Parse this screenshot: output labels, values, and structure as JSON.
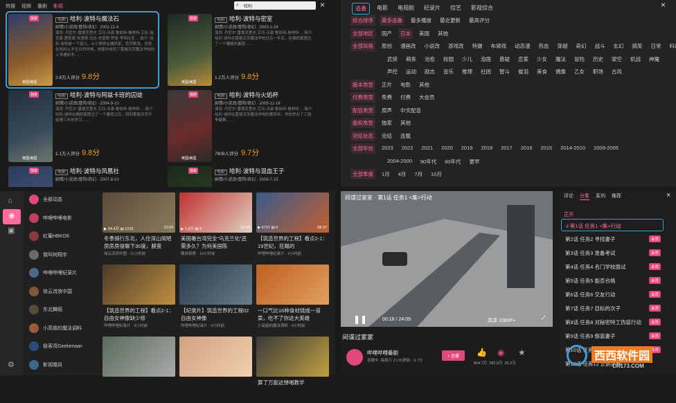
{
  "top_left": {
    "tabs": [
      "热搜",
      "视频",
      "番剧",
      "影视"
    ],
    "active_tab": "影视",
    "search_value": "哈利",
    "cards": [
      {
        "tag": "独家",
        "title": "哈利·波特与魔法石",
        "meta": "剧情/小说改/冒险/奇幻 · 2001-11-4",
        "desc": "演员: 丹尼尔·雷德克里夫 艾玛·沃森 鲁伯特·格林特 艾伦·瑞克曼 理查德·哈里斯 玛吉·史密斯 罗彼·考特拉尼 ... 简介: 哈利·波特是一个孤儿，从小寄养在姨妈家，受尽欺凌。但就在哈利11岁生日的时候，他意外收到了霍格沃茨魔法学校的入学通知书……",
        "count": "2.8万人评分",
        "score": "9.8分",
        "region": "英国/美国"
      },
      {
        "tag": "独家",
        "title": "哈利·波特与密室",
        "meta": "剧情/小说改/冒险/奇幻 · 2003-1-24",
        "desc": "演员: 丹尼尔·雷德克里夫 艾玛·沃森 鲁伯特·格林特 ... 简介: 哈利·波特在霍格沃茨魔法学校过完一年后，在姨妈家度过了一个糟糕的暑假……",
        "count": "1.2万人评分",
        "score": "9.8分",
        "region": "英国/美国"
      },
      {
        "tag": "独家",
        "title": "哈利·波特与阿兹卡班的囚徒",
        "meta": "剧情/小说改/冒险/奇幻 · 2004-9-10",
        "desc": "演员: 丹尼尔·雷德克里夫 艾玛·沃森 鲁伯特·格林特 ... 简介: 哈利·波特在姨妈家度过了一个暑假之后，回到霍格沃茨开始第三年的学习……",
        "count": "1.1万人评分",
        "score": "9.8分",
        "region": "英国/美国"
      },
      {
        "tag": "独家",
        "title": "哈利·波特与火焰杯",
        "meta": "剧情/小说改/冒险/奇幻 · 2005-11-18",
        "desc": "演员: 丹尼尔·雷德克里夫 艾玛·沃森 鲁伯特·格林特 ... 简介: 哈利·波特在霍格沃茨魔法学校的第四年，学校举办了三强争霸赛……",
        "count": "7808人评分",
        "score": "9.7分",
        "region": "英国/美国"
      },
      {
        "tag": "独家",
        "title": "哈利·波特与凤凰社",
        "meta": "剧情/小说改/冒险/奇幻 · 2007-8-10",
        "desc": "",
        "count": "",
        "score": "",
        "region": ""
      },
      {
        "tag": "独家",
        "title": "哈利·波特与混血王子",
        "meta": "剧情/小说改/冒险/奇幻 · 2009-7-15",
        "desc": "",
        "count": "",
        "score": "",
        "region": ""
      }
    ]
  },
  "top_right": {
    "tabs": [
      "追番",
      "电影",
      "电视剧",
      "纪录片",
      "综艺",
      "影视综合"
    ],
    "active_tab": "追番",
    "filters": [
      {
        "label": "综合排序",
        "options": [
          "最多追番",
          "最多播放",
          "最近更新",
          "最高评分"
        ],
        "on": "最多追番"
      },
      {
        "label": "全部地区",
        "options": [
          "国产",
          "日本",
          "美国",
          "其他"
        ],
        "on": "日本"
      },
      {
        "label": "全部风格",
        "options": [
          "原创",
          "漫画改",
          "小说改",
          "游戏改",
          "特摄",
          "布袋戏",
          "动态漫",
          "热血",
          "穿越",
          "奇幻",
          "战斗",
          "玄幻",
          "搞笑",
          "日常",
          "科幻",
          "武侠",
          "萌系",
          "治愈",
          "校园",
          "少儿",
          "泡面",
          "悬疑",
          "恋爱",
          "少女",
          "魔法",
          "冒险",
          "历史",
          "架空",
          "机战",
          "神魔",
          "声控",
          "运动",
          "励志",
          "音乐",
          "推理",
          "社团",
          "智斗",
          "催泪",
          "美食",
          "偶像",
          "乙女",
          "职场",
          "古风"
        ],
        "on": ""
      },
      {
        "label": "版本类型",
        "options": [
          "正片",
          "电影",
          "其他"
        ],
        "on": ""
      },
      {
        "label": "付费类型",
        "options": [
          "免费",
          "付费",
          "大会员"
        ],
        "on": ""
      },
      {
        "label": "配音类型",
        "options": [
          "原声",
          "中文配音"
        ],
        "on": ""
      },
      {
        "label": "版权类型",
        "options": [
          "独家",
          "其他"
        ],
        "on": ""
      },
      {
        "label": "完结状态",
        "options": [
          "完结",
          "连载"
        ],
        "on": ""
      },
      {
        "label": "全部年份",
        "options": [
          "2023",
          "2022",
          "2021",
          "2020",
          "2019",
          "2018",
          "2017",
          "2016",
          "2015",
          "2014-2010",
          "2009-2005",
          "2004-2000",
          "90年代",
          "80年代",
          "更早"
        ],
        "on": ""
      },
      {
        "label": "全部季度",
        "options": [
          "1月",
          "4月",
          "7月",
          "10月"
        ],
        "on": ""
      }
    ]
  },
  "bottom_left": {
    "channels": [
      "全部动态",
      "哔哩哔哩电影",
      "红葡HBKO8",
      "我叫何翔宇",
      "哔哩哔哩纪录片",
      "徐云流浪中国",
      "东北舞蹈",
      "小高姐的魔法调料",
      "极客湾Geekerwan",
      "影视飓风"
    ],
    "videos": [
      {
        "views": "24.4万",
        "dm": "1219",
        "dur": "13:04",
        "title": "冬季骑行东北，人住深山简陋房房房侵聊下30度，膜蛮",
        "up": "徐云流浪中国 · 11小时前"
      },
      {
        "views": "1.6万",
        "dm": "0",
        "dur": "03:48",
        "title": "美国署台湾完全“乌克兰化”还需多久？为何美国陈",
        "up": "鹰网观察 · 10小时前"
      },
      {
        "views": "6727",
        "dm": "0",
        "dur": "08:37",
        "title": "【筑造世界的工程】看点2-1：19世纪，狂飓的",
        "up": "哔哩哔哩纪录片 · 9小时前"
      },
      {
        "views": "",
        "dm": "",
        "dur": "",
        "title": "【筑造世界的工程】看点2-1：自由女神像缺少修",
        "up": "哔哩哔哩纪录片 · 9小时前"
      },
      {
        "views": "",
        "dm": "",
        "dur": "",
        "title": "【纪录片】筑造世界的工程02自由女神像",
        "up": "哔哩哔哩纪录片 · 9小时前"
      },
      {
        "views": "",
        "dm": "",
        "dur": "",
        "title": "一口气比16种食材烧成一道菜，吃不了你这大英雄",
        "up": "小高姐的魔法调料 · 9小时前"
      },
      {
        "views": "",
        "dm": "",
        "dur": "",
        "title": "",
        "up": ""
      },
      {
        "views": "",
        "dm": "",
        "dur": "",
        "title": "",
        "up": ""
      },
      {
        "views": "",
        "dm": "",
        "dur": "",
        "title": "算了万能这弹唱教学",
        "up": ""
      }
    ]
  },
  "bottom_right": {
    "player": {
      "overlay": "间谍过家家 · 第1话 任务1 <集>行动",
      "time": "00:18 / 24:09",
      "quality": "高清 1080P+"
    },
    "tabs": [
      "评论",
      "分集",
      "系列",
      "推荐"
    ],
    "active_tab": "分集",
    "section": "正片",
    "episodes": [
      {
        "label": "第1话 任务1 <集>行动",
        "badge": ""
      },
      {
        "label": "第2话 任务2 寻找妻子",
        "badge": "会员"
      },
      {
        "label": "第3话 任务3 准备考试",
        "badge": "会员"
      },
      {
        "label": "第4话 任务4 名门学校面试",
        "badge": "会员"
      },
      {
        "label": "第5话 任务5 能否合格",
        "badge": "会员"
      },
      {
        "label": "第6话 任务6 交友行动",
        "badge": "会员"
      },
      {
        "label": "第7话 任务7 目标的次子",
        "badge": "会员"
      },
      {
        "label": "第8话 任务8 对秘密特工伪装行动",
        "badge": "会员"
      },
      {
        "label": "第9话 任务9 假装妻子",
        "badge": "会员"
      },
      {
        "label": "第10话 任务10 躲避球大作战",
        "badge": "会员"
      },
      {
        "label": "第12话 任务12 企鹅乐园",
        "badge": ""
      }
    ],
    "show_title": "间谍过家家",
    "uploader": "哔哩哔哩番剧",
    "uploader_meta": "连载中, 每周六 21:00更新 · 9.7分",
    "follow_label": "+ 追番",
    "stats": [
      "804.7万",
      "282.8万",
      "65.2万"
    ]
  },
  "colors": {
    "accent": "#ff6b9d",
    "focus": "#3fa0d8",
    "score": "#f0a020"
  }
}
